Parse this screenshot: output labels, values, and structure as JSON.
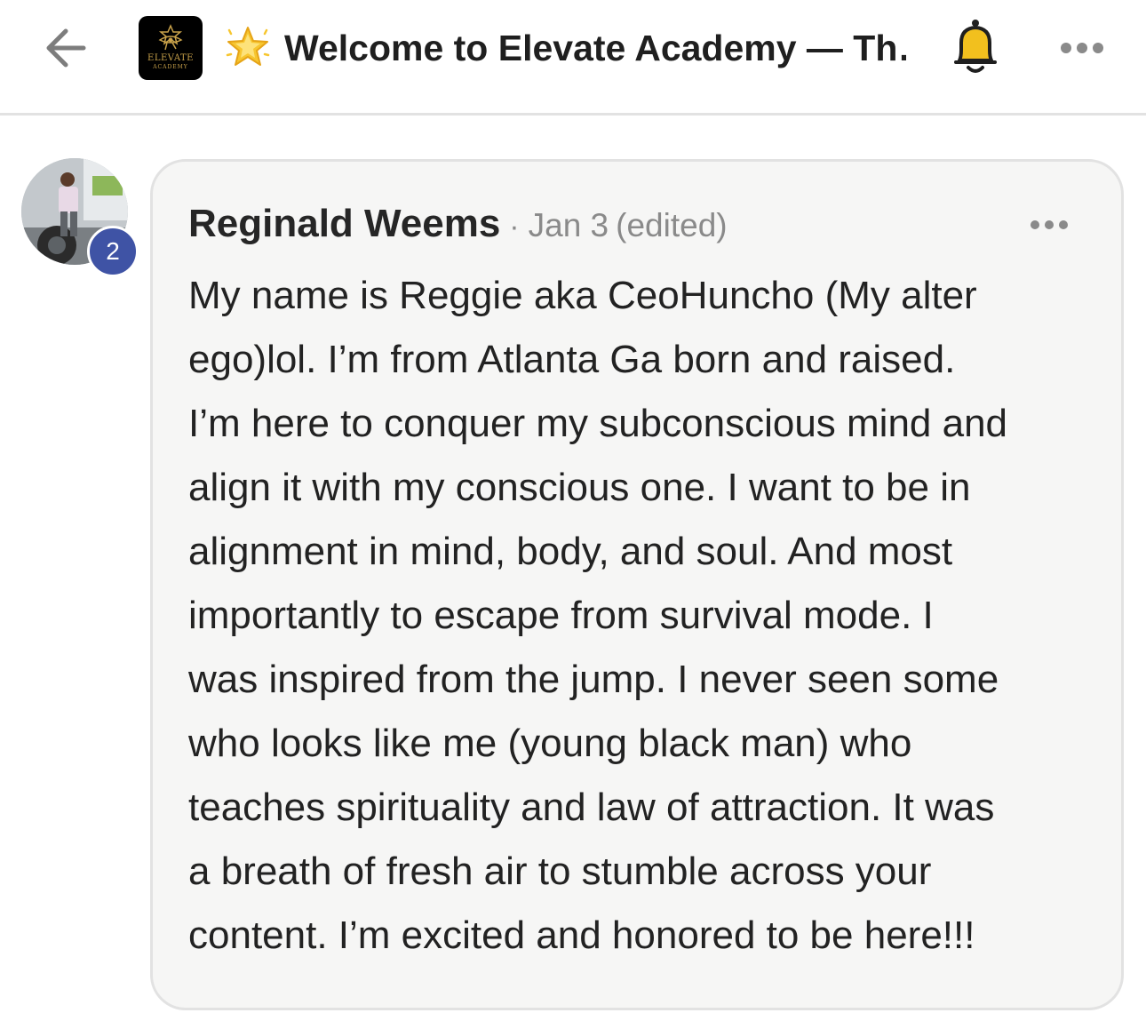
{
  "header": {
    "back_icon": "arrow-left-icon",
    "group_logo": {
      "word": "ELEVATE",
      "sub": "ACADEMY"
    },
    "channel_emoji": "glowing-star-icon",
    "title": "Welcome to Elevate Academy — Th…",
    "bell_icon": "bell-icon",
    "more_icon": "more-horizontal-icon"
  },
  "post": {
    "author": "Reginald Weems",
    "separator": "·",
    "date": "Jan 3",
    "edited": "(edited)",
    "level": "2",
    "more_icon": "more-horizontal-icon",
    "body_lines": [
      "My name is Reggie aka CeoHuncho (My alter",
      "ego)lol. I’m from Atlanta Ga born and raised.",
      "I’m here to conquer my subconscious mind and",
      "align it with my conscious one. I want to be in",
      "alignment in mind, body, and soul. And most",
      "importantly to escape from survival mode. I",
      "was inspired from the jump. I never seen some",
      "who looks like me (young black man) who",
      "teaches spirituality and law of attraction. It was",
      "a breath of fresh air to stumble across your",
      "content. I’m excited and honored to be here!!!"
    ]
  },
  "colors": {
    "badge": "#3f53a5",
    "card_bg": "#f6f6f5",
    "card_border": "#e2e2e2",
    "bell": "#f2c01e",
    "logo_gold": "#c9a24a"
  }
}
